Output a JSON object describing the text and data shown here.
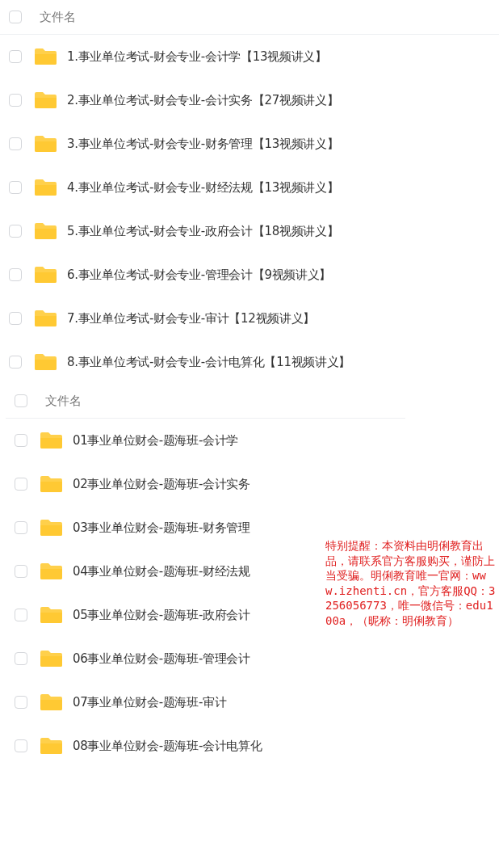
{
  "lists": [
    {
      "header": {
        "label": "文件名",
        "checked": false
      },
      "rows": [
        {
          "name": "1.事业单位考试-财会专业-会计学【13视频讲义】",
          "checked": false
        },
        {
          "name": "2.事业单位考试-财会专业-会计实务【27视频讲义】",
          "checked": false
        },
        {
          "name": "3.事业单位考试-财会专业-财务管理【13视频讲义】",
          "checked": false
        },
        {
          "name": "4.事业单位考试-财会专业-财经法规【13视频讲义】",
          "checked": false
        },
        {
          "name": "5.事业单位考试-财会专业-政府会计【18视频讲义】",
          "checked": false
        },
        {
          "name": "6.事业单位考试-财会专业-管理会计【9视频讲义】",
          "checked": false
        },
        {
          "name": "7.事业单位考试-财会专业-审计【12视频讲义】",
          "checked": false
        },
        {
          "name": "8.事业单位考试-财会专业-会计电算化【11视频讲义】",
          "checked": false
        }
      ]
    },
    {
      "header": {
        "label": "文件名",
        "checked": false
      },
      "rows": [
        {
          "name": "01事业单位财会-题海班-会计学",
          "checked": false
        },
        {
          "name": "02事业单位财会-题海班-会计实务",
          "checked": false
        },
        {
          "name": "03事业单位财会-题海班-财务管理",
          "checked": false
        },
        {
          "name": "04事业单位财会-题海班-财经法规",
          "checked": false
        },
        {
          "name": "05事业单位财会-题海班-政府会计",
          "checked": false
        },
        {
          "name": "06事业单位财会-题海班-管理会计",
          "checked": false
        },
        {
          "name": "07事业单位财会-题海班-审计",
          "checked": false
        },
        {
          "name": "08事业单位财会-题海班-会计电算化",
          "checked": false
        }
      ]
    }
  ],
  "notice": "特别提醒：本资料由明俐教育出品，请联系官方客服购买，谨防上当受骗。明俐教育唯一官网：www.izhenti.cn，官方客服QQ：3256056773，唯一微信号：edu100a，（昵称：明俐教育）"
}
